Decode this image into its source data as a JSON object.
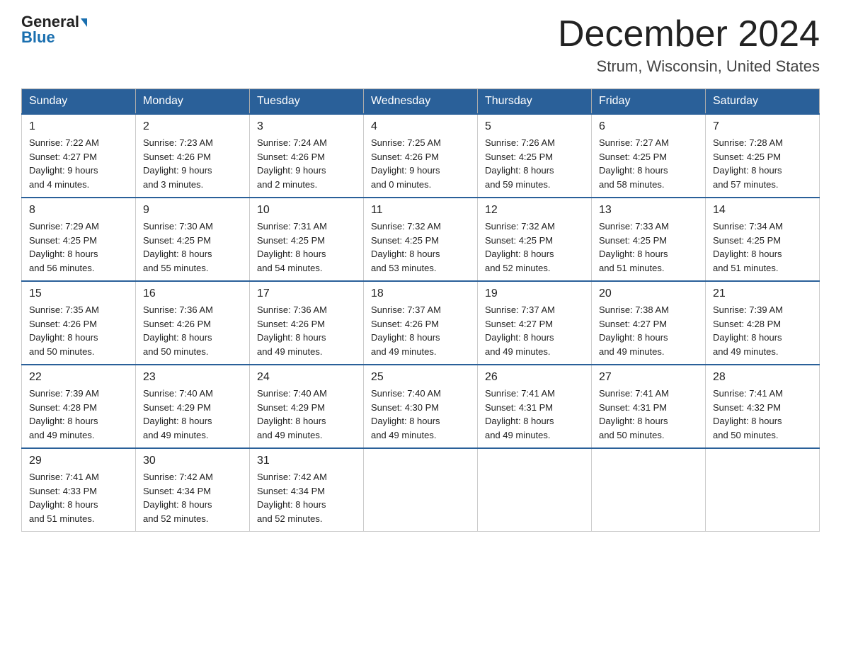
{
  "logo": {
    "line1_regular": "General",
    "line1_arrow": "▶",
    "line2": "Blue"
  },
  "title": {
    "month": "December 2024",
    "location": "Strum, Wisconsin, United States"
  },
  "weekdays": [
    "Sunday",
    "Monday",
    "Tuesday",
    "Wednesday",
    "Thursday",
    "Friday",
    "Saturday"
  ],
  "weeks": [
    [
      {
        "day": "1",
        "info": "Sunrise: 7:22 AM\nSunset: 4:27 PM\nDaylight: 9 hours\nand 4 minutes."
      },
      {
        "day": "2",
        "info": "Sunrise: 7:23 AM\nSunset: 4:26 PM\nDaylight: 9 hours\nand 3 minutes."
      },
      {
        "day": "3",
        "info": "Sunrise: 7:24 AM\nSunset: 4:26 PM\nDaylight: 9 hours\nand 2 minutes."
      },
      {
        "day": "4",
        "info": "Sunrise: 7:25 AM\nSunset: 4:26 PM\nDaylight: 9 hours\nand 0 minutes."
      },
      {
        "day": "5",
        "info": "Sunrise: 7:26 AM\nSunset: 4:25 PM\nDaylight: 8 hours\nand 59 minutes."
      },
      {
        "day": "6",
        "info": "Sunrise: 7:27 AM\nSunset: 4:25 PM\nDaylight: 8 hours\nand 58 minutes."
      },
      {
        "day": "7",
        "info": "Sunrise: 7:28 AM\nSunset: 4:25 PM\nDaylight: 8 hours\nand 57 minutes."
      }
    ],
    [
      {
        "day": "8",
        "info": "Sunrise: 7:29 AM\nSunset: 4:25 PM\nDaylight: 8 hours\nand 56 minutes."
      },
      {
        "day": "9",
        "info": "Sunrise: 7:30 AM\nSunset: 4:25 PM\nDaylight: 8 hours\nand 55 minutes."
      },
      {
        "day": "10",
        "info": "Sunrise: 7:31 AM\nSunset: 4:25 PM\nDaylight: 8 hours\nand 54 minutes."
      },
      {
        "day": "11",
        "info": "Sunrise: 7:32 AM\nSunset: 4:25 PM\nDaylight: 8 hours\nand 53 minutes."
      },
      {
        "day": "12",
        "info": "Sunrise: 7:32 AM\nSunset: 4:25 PM\nDaylight: 8 hours\nand 52 minutes."
      },
      {
        "day": "13",
        "info": "Sunrise: 7:33 AM\nSunset: 4:25 PM\nDaylight: 8 hours\nand 51 minutes."
      },
      {
        "day": "14",
        "info": "Sunrise: 7:34 AM\nSunset: 4:25 PM\nDaylight: 8 hours\nand 51 minutes."
      }
    ],
    [
      {
        "day": "15",
        "info": "Sunrise: 7:35 AM\nSunset: 4:26 PM\nDaylight: 8 hours\nand 50 minutes."
      },
      {
        "day": "16",
        "info": "Sunrise: 7:36 AM\nSunset: 4:26 PM\nDaylight: 8 hours\nand 50 minutes."
      },
      {
        "day": "17",
        "info": "Sunrise: 7:36 AM\nSunset: 4:26 PM\nDaylight: 8 hours\nand 49 minutes."
      },
      {
        "day": "18",
        "info": "Sunrise: 7:37 AM\nSunset: 4:26 PM\nDaylight: 8 hours\nand 49 minutes."
      },
      {
        "day": "19",
        "info": "Sunrise: 7:37 AM\nSunset: 4:27 PM\nDaylight: 8 hours\nand 49 minutes."
      },
      {
        "day": "20",
        "info": "Sunrise: 7:38 AM\nSunset: 4:27 PM\nDaylight: 8 hours\nand 49 minutes."
      },
      {
        "day": "21",
        "info": "Sunrise: 7:39 AM\nSunset: 4:28 PM\nDaylight: 8 hours\nand 49 minutes."
      }
    ],
    [
      {
        "day": "22",
        "info": "Sunrise: 7:39 AM\nSunset: 4:28 PM\nDaylight: 8 hours\nand 49 minutes."
      },
      {
        "day": "23",
        "info": "Sunrise: 7:40 AM\nSunset: 4:29 PM\nDaylight: 8 hours\nand 49 minutes."
      },
      {
        "day": "24",
        "info": "Sunrise: 7:40 AM\nSunset: 4:29 PM\nDaylight: 8 hours\nand 49 minutes."
      },
      {
        "day": "25",
        "info": "Sunrise: 7:40 AM\nSunset: 4:30 PM\nDaylight: 8 hours\nand 49 minutes."
      },
      {
        "day": "26",
        "info": "Sunrise: 7:41 AM\nSunset: 4:31 PM\nDaylight: 8 hours\nand 49 minutes."
      },
      {
        "day": "27",
        "info": "Sunrise: 7:41 AM\nSunset: 4:31 PM\nDaylight: 8 hours\nand 50 minutes."
      },
      {
        "day": "28",
        "info": "Sunrise: 7:41 AM\nSunset: 4:32 PM\nDaylight: 8 hours\nand 50 minutes."
      }
    ],
    [
      {
        "day": "29",
        "info": "Sunrise: 7:41 AM\nSunset: 4:33 PM\nDaylight: 8 hours\nand 51 minutes."
      },
      {
        "day": "30",
        "info": "Sunrise: 7:42 AM\nSunset: 4:34 PM\nDaylight: 8 hours\nand 52 minutes."
      },
      {
        "day": "31",
        "info": "Sunrise: 7:42 AM\nSunset: 4:34 PM\nDaylight: 8 hours\nand 52 minutes."
      },
      null,
      null,
      null,
      null
    ]
  ]
}
